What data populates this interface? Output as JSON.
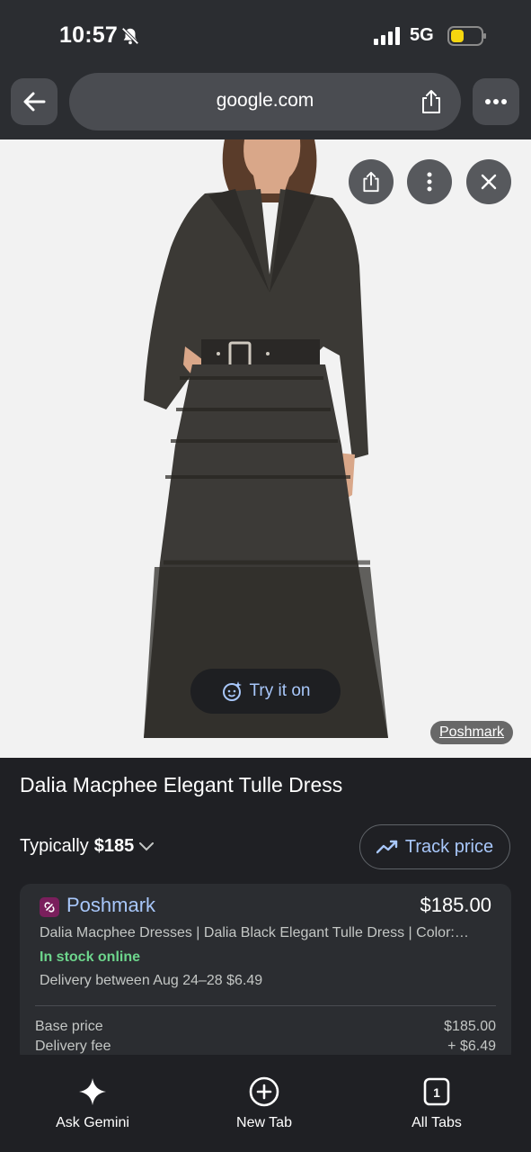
{
  "status_bar": {
    "time": "10:57",
    "network": "5G"
  },
  "browser": {
    "url": "google.com"
  },
  "image": {
    "try_on_label": "Try it on",
    "source_label": "Poshmark"
  },
  "product": {
    "title": "Dalia Macphee Elegant Tulle Dress",
    "typical_prefix": "Typically",
    "typical_price": "$185",
    "track_price_label": "Track price"
  },
  "offer": {
    "store": "Poshmark",
    "price": "$185.00",
    "description": "Dalia Macphee Dresses | Dalia Black Elegant Tulle Dress | Color:…",
    "stock": "In stock online",
    "delivery": "Delivery between Aug 24–28 $6.49",
    "rows": [
      {
        "label": "Base price",
        "value": "$185.00"
      },
      {
        "label": "Delivery fee",
        "value": "+ $6.49"
      }
    ]
  },
  "bottom_nav": {
    "gemini_label": "Ask Gemini",
    "new_tab_label": "New Tab",
    "tabs_label": "All Tabs",
    "tab_count": "1"
  },
  "colors": {
    "accent_blue": "#a8c7fa",
    "stock_green": "#6dd58c",
    "poshmark_brand": "#7a1f5c"
  }
}
